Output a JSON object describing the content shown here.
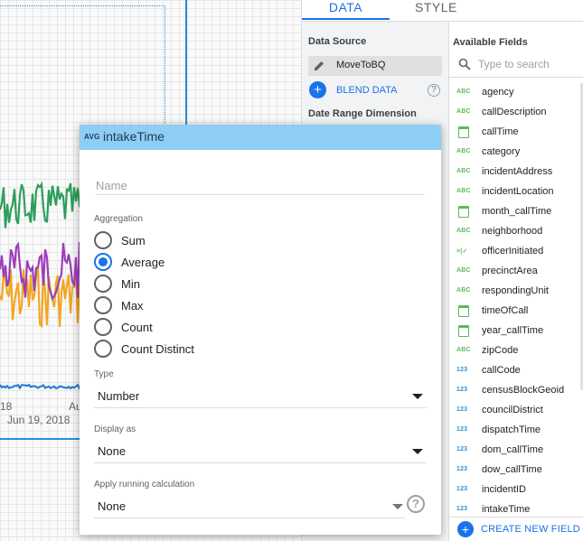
{
  "canvas": {
    "x_tick_labels": [
      "18",
      "Au",
      "Jun 19, 2018"
    ],
    "series_colors": {
      "green": "#2e9e5b",
      "purple": "#9b3fb8",
      "orange": "#f2a623",
      "blue": "#2b7fd4"
    }
  },
  "panel": {
    "tabs": {
      "data": "DATA",
      "style": "STYLE"
    },
    "data_source_title": "Data Source",
    "data_source_name": "MoveToBQ",
    "blend_label": "BLEND DATA",
    "help_symbol": "?",
    "date_range_title": "Date Range Dimension",
    "available_fields_title": "Available Fields",
    "search_placeholder": "Type to search",
    "fields": [
      {
        "type": "text",
        "tag": "ABC",
        "name": "agency"
      },
      {
        "type": "text",
        "tag": "ABC",
        "name": "callDescription"
      },
      {
        "type": "date",
        "tag": "",
        "name": "callTime"
      },
      {
        "type": "text",
        "tag": "ABC",
        "name": "category"
      },
      {
        "type": "text",
        "tag": "ABC",
        "name": "incidentAddress"
      },
      {
        "type": "text",
        "tag": "ABC",
        "name": "incidentLocation"
      },
      {
        "type": "date",
        "tag": "",
        "name": "month_callTime"
      },
      {
        "type": "text",
        "tag": "ABC",
        "name": "neighborhood"
      },
      {
        "type": "bool",
        "tag": "×|✓",
        "name": "officerInitiated"
      },
      {
        "type": "text",
        "tag": "ABC",
        "name": "precinctArea"
      },
      {
        "type": "text",
        "tag": "ABC",
        "name": "respondingUnit"
      },
      {
        "type": "date",
        "tag": "",
        "name": "timeOfCall"
      },
      {
        "type": "date",
        "tag": "",
        "name": "year_callTime"
      },
      {
        "type": "text",
        "tag": "ABC",
        "name": "zipCode"
      },
      {
        "type": "number",
        "tag": "123",
        "name": "callCode"
      },
      {
        "type": "number",
        "tag": "123",
        "name": "censusBlockGeoid"
      },
      {
        "type": "number",
        "tag": "123",
        "name": "councilDistrict"
      },
      {
        "type": "number",
        "tag": "123",
        "name": "dispatchTime"
      },
      {
        "type": "number",
        "tag": "123",
        "name": "dom_callTime"
      },
      {
        "type": "number",
        "tag": "123",
        "name": "dow_callTime"
      },
      {
        "type": "number",
        "tag": "123",
        "name": "incidentID"
      },
      {
        "type": "number",
        "tag": "123",
        "name": "intakeTime"
      }
    ],
    "create_field_label": "CREATE NEW FIELD"
  },
  "popup": {
    "agg_tag": "AVG",
    "title": "intakeTime",
    "name_placeholder": "Name",
    "aggregation_label": "Aggregation",
    "aggregation_options": [
      "Sum",
      "Average",
      "Min",
      "Max",
      "Count",
      "Count Distinct"
    ],
    "aggregation_selected": "Average",
    "type_label": "Type",
    "type_value": "Number",
    "display_as_label": "Display as",
    "display_as_value": "None",
    "running_calc_label": "Apply running calculation",
    "running_calc_value": "None",
    "help_symbol": "?"
  }
}
